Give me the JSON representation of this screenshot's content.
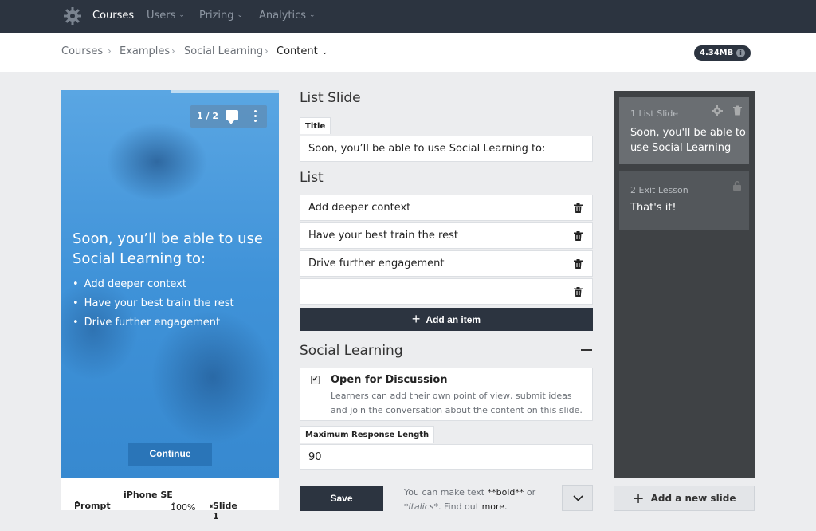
{
  "nav": {
    "items": [
      {
        "label": "Courses",
        "active": true,
        "caret": false
      },
      {
        "label": "Users",
        "active": false,
        "caret": true
      },
      {
        "label": "Prizing",
        "active": false,
        "caret": true
      },
      {
        "label": "Analytics",
        "active": false,
        "caret": true
      }
    ]
  },
  "breadcrumb": {
    "items": [
      "Courses",
      "Examples",
      "Social Learning"
    ],
    "current": "Content",
    "size": "4.34MB"
  },
  "preview": {
    "pager": "1 / 2",
    "headline": "Soon, you’ll be able to use Social Learning to:",
    "bullets": [
      "Add deeper context",
      "Have your best train the rest",
      "Drive further engagement"
    ],
    "continue_label": "Continue",
    "footer": {
      "prompt": "Prompt",
      "device": "iPhone SE",
      "zoom": "100%",
      "slide": "Slide 1"
    }
  },
  "editor": {
    "heading": "List Slide",
    "title_label": "Title",
    "title_value": "Soon, you’ll be able to use Social Learning to:",
    "list_heading": "List",
    "list_items": [
      "Add deeper context",
      "Have your best train the rest",
      "Drive further engagement",
      ""
    ],
    "add_item_label": "Add an item",
    "social_heading": "Social Learning",
    "discussion_title": "Open for Discussion",
    "discussion_desc": "Learners can add their own point of view, submit ideas and join the conversation about the content on this slide.",
    "max_length_label": "Maximum Response Length",
    "max_length_value": "90",
    "save_label": "Save",
    "hint_prefix": "You can make text ",
    "hint_bold": "**bold**",
    "hint_mid": " or ",
    "hint_italic": "*italics*",
    "hint_suffix": ". Find out ",
    "hint_link": "more."
  },
  "slides": [
    {
      "meta": "1  List Slide",
      "text": "Soon, you'll be able to use Social Learning"
    },
    {
      "meta": "2  Exit Lesson",
      "text": "That's it!"
    }
  ],
  "add_slide_label": "Add a new slide",
  "colors": {
    "nav_bg": "#2c3440",
    "preview_blue": "#3e91d8",
    "panel_bg": "#3f4245"
  }
}
